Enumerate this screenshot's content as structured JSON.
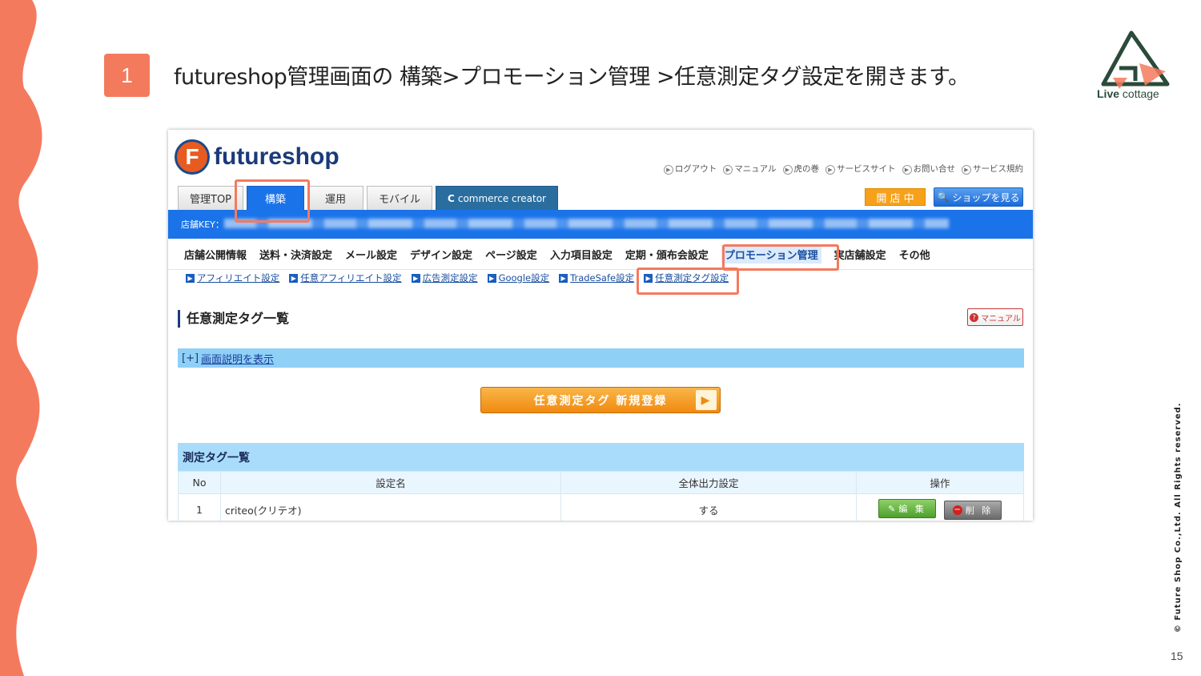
{
  "slide": {
    "step_number": "1",
    "instruction": "futureshop管理画面の 構築>プロモーション管理 >任意測定タグ設定を開きます。",
    "brand_name_bold": "Live",
    "brand_name_light": "cottage",
    "copyright": "© Future Shop Co.,Ltd. All Rights reserved.",
    "page_number": "15",
    "accent_color": "#f47a5e"
  },
  "screenshot": {
    "logo_text": "futureshop",
    "top_links": [
      "ログアウト",
      "マニュアル",
      "虎の巻",
      "サービスサイト",
      "お問い合せ",
      "サービス規約"
    ],
    "tabs": [
      {
        "label": "管理TOP",
        "active": false
      },
      {
        "label": "構築",
        "active": true
      },
      {
        "label": "運用",
        "active": false
      },
      {
        "label": "モバイル",
        "active": false
      },
      {
        "label": "commerce creator",
        "active": false
      }
    ],
    "store_status": "開 店 中",
    "view_shop_label": "ショップを見る",
    "store_key_label": "店舗KEY：",
    "main_menu": [
      "店舗公開情報",
      "送料・決済設定",
      "メール設定",
      "デザイン設定",
      "ページ設定",
      "入力項目設定",
      "定期・頒布会設定",
      "プロモーション管理",
      "実店舗設定",
      "その他"
    ],
    "main_menu_selected": "プロモーション管理",
    "sub_menu": [
      "アフィリエイト設定",
      "任意アフィリエイト設定",
      "広告測定設定",
      "Google設定",
      "TradeSafe設定",
      "任意測定タグ設定"
    ],
    "section_title": "任意測定タグ一覧",
    "manual_button": "マニュアル",
    "explain_prefix": "[+]",
    "explain_link": "画面説明を表示",
    "new_button": "任意測定タグ 新規登録",
    "list_title": "測定タグ一覧",
    "table": {
      "headers": [
        "No",
        "設定名",
        "全体出力設定",
        "操作"
      ],
      "rows": [
        {
          "no": "1",
          "name": "criteo(クリテオ)",
          "output": "する",
          "edit": "編 集",
          "delete": "削 除"
        }
      ]
    }
  }
}
